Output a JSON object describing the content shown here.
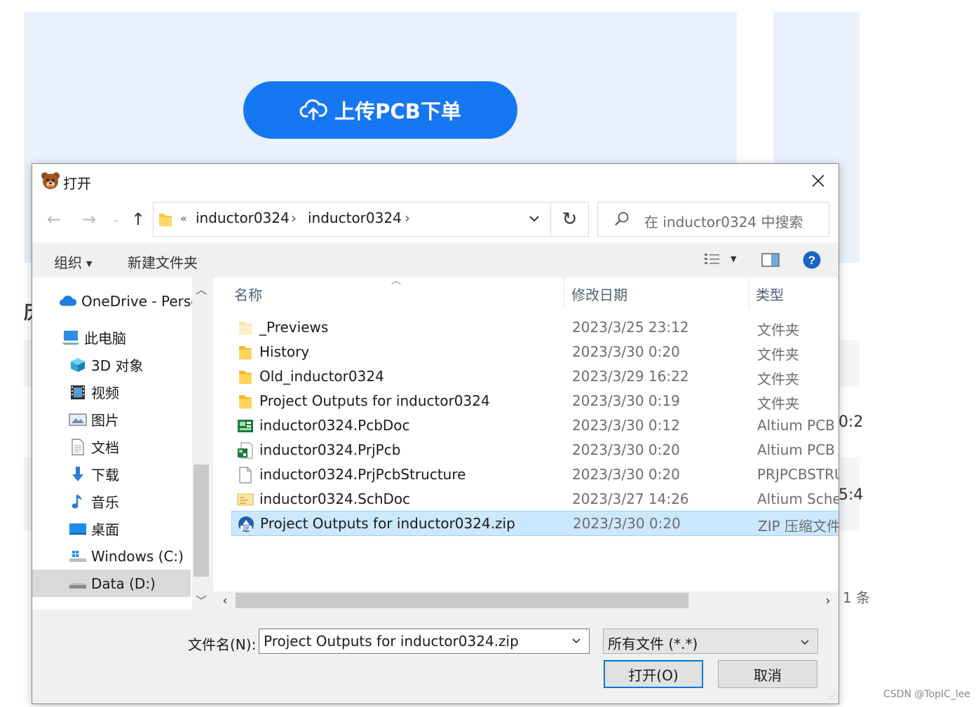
{
  "background": {
    "upload_label": "上传PCB下单",
    "side_char": "历",
    "peek_1": "0:2",
    "peek_2": "5:4",
    "peek_3": "1 条",
    "watermark": "CSDN @TopIC_lee"
  },
  "dialog": {
    "title": "打开",
    "address": {
      "overflow": "«",
      "crumbs": [
        "inductor0324",
        "inductor0324"
      ]
    },
    "search_placeholder": "在 inductor0324 中搜索",
    "toolbar": {
      "organize": "组织",
      "new_folder": "新建文件夹"
    },
    "nav_items": [
      {
        "label": "OneDrive - Personal",
        "icon": "onedrive-icon"
      },
      {
        "label": "此电脑",
        "icon": "computer-icon"
      },
      {
        "label": "3D 对象",
        "icon": "3d-objects-icon"
      },
      {
        "label": "视频",
        "icon": "video-icon"
      },
      {
        "label": "图片",
        "icon": "pictures-icon"
      },
      {
        "label": "文档",
        "icon": "documents-icon"
      },
      {
        "label": "下载",
        "icon": "download-icon"
      },
      {
        "label": "音乐",
        "icon": "music-icon"
      },
      {
        "label": "桌面",
        "icon": "desktop-icon"
      },
      {
        "label": "Windows (C:)",
        "icon": "drive-c-icon"
      },
      {
        "label": "Data (D:)",
        "icon": "drive-d-icon"
      }
    ],
    "columns": {
      "name": "名称",
      "date": "修改日期",
      "type": "类型"
    },
    "files": [
      {
        "name": "_Previews",
        "date": "2023/3/25 23:12",
        "type": "文件夹",
        "icon": "folder-light-icon"
      },
      {
        "name": "History",
        "date": "2023/3/30 0:20",
        "type": "文件夹",
        "icon": "folder-icon"
      },
      {
        "name": "Old_inductor0324",
        "date": "2023/3/29 16:22",
        "type": "文件夹",
        "icon": "folder-icon"
      },
      {
        "name": "Project Outputs for inductor0324",
        "date": "2023/3/30 0:19",
        "type": "文件夹",
        "icon": "folder-icon"
      },
      {
        "name": "inductor0324.PcbDoc",
        "date": "2023/3/30 0:12",
        "type": "Altium PCB",
        "icon": "pcbdoc-icon"
      },
      {
        "name": "inductor0324.PrjPcb",
        "date": "2023/3/30 0:20",
        "type": "Altium PCB F",
        "icon": "prjpcb-icon"
      },
      {
        "name": "inductor0324.PrjPcbStructure",
        "date": "2023/3/30 0:20",
        "type": "PRJPCBSTRU",
        "icon": "blank-file-icon"
      },
      {
        "name": "inductor0324.SchDoc",
        "date": "2023/3/27 14:26",
        "type": "Altium Sche",
        "icon": "schdoc-icon"
      },
      {
        "name": "Project Outputs for inductor0324.zip",
        "date": "2023/3/30 0:20",
        "type": "ZIP 压缩文件",
        "icon": "zip-icon"
      }
    ],
    "filename_label": "文件名(N):",
    "filename_value": "Project Outputs for inductor0324.zip",
    "filetype_value": "所有文件 (*.*)",
    "open_label": "打开(O)",
    "cancel_label": "取消"
  }
}
